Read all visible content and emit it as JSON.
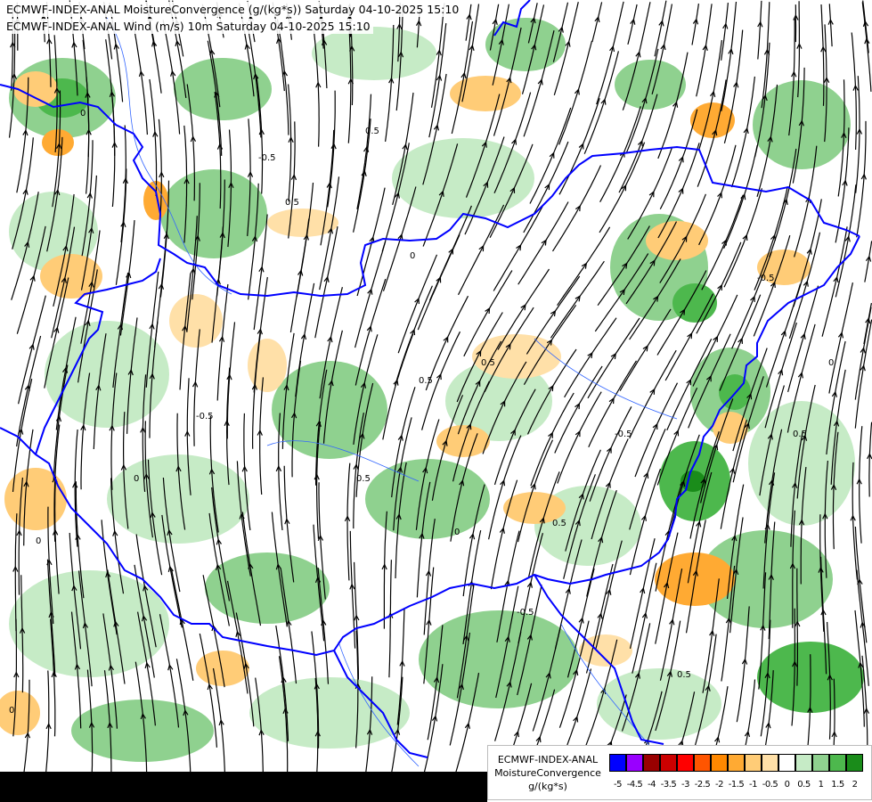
{
  "titles": {
    "line1": "ECMWF-INDEX-ANAL MoistureConvergence (g/(kg*s)) Saturday 04-10-2025 15:10",
    "line2": "ECMWF-INDEX-ANAL Wind (m/s) 10m Saturday 04-10-2025 15:10"
  },
  "legend": {
    "source": "ECMWF-INDEX-ANAL",
    "variable": "MoistureConvergence",
    "unit": "g/(kg*s)",
    "ticks": [
      "-5",
      "-4.5",
      "-4",
      "-3.5",
      "-3",
      "-2.5",
      "-2",
      "-1.5",
      "-1",
      "-0.5",
      "0",
      "0.5",
      "1",
      "1.5",
      "2"
    ],
    "colors": [
      "#0000ff",
      "#9900ff",
      "#990000",
      "#cc0000",
      "#ff0000",
      "#ff5500",
      "#ff8800",
      "#ffaa33",
      "#ffcc77",
      "#ffe0a8",
      "#ffffff",
      "#c6ebc6",
      "#8fd18f",
      "#4db84d",
      "#1a8c1a"
    ]
  },
  "contour_labels": [
    "0",
    "0.5",
    "-0.5",
    "0.5",
    "0",
    "-0.5",
    "0.5",
    "0",
    "0.5",
    "-0.5",
    "0",
    "0.5",
    "0",
    "-0.5",
    "0.5",
    "0",
    "0.5",
    "-0.5",
    "0",
    "0.5"
  ],
  "colors": {
    "border": "#0000ff",
    "river": "#3366ff",
    "streamline": "#000000"
  }
}
